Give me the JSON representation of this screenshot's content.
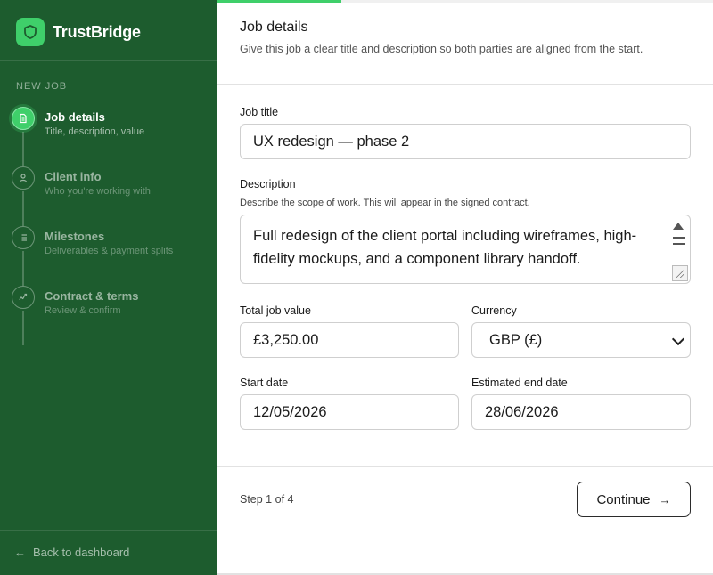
{
  "app": {
    "brand": "TrustBridge",
    "accent_color": "#3fcf6a",
    "sidebar_color": "#1d5c2e"
  },
  "sidebar": {
    "section_label": "NEW JOB",
    "steps": [
      {
        "title": "Job details",
        "subtitle": "Title, description, value",
        "icon": "document-icon",
        "active": true
      },
      {
        "title": "Client info",
        "subtitle": "Who you're working with",
        "icon": "user-icon",
        "active": false
      },
      {
        "title": "Milestones",
        "subtitle": "Deliverables & payment splits",
        "icon": "list-icon",
        "active": false
      },
      {
        "title": "Contract & terms",
        "subtitle": "Review & confirm",
        "icon": "signature-icon",
        "active": false
      }
    ],
    "back_label": "Back to dashboard"
  },
  "progress": {
    "fraction": 0.25
  },
  "header": {
    "title": "Job details",
    "subtitle": "Give this job a clear title and description so both parties are aligned from the start."
  },
  "form": {
    "job_title_label": "Job title",
    "job_title_value": "UX redesign — phase 2",
    "description_label": "Description",
    "description_hint": "Describe the scope of work. This will appear in the signed contract.",
    "description_value": "Full redesign of the client portal including wireframes, high-fidelity mockups, and a component library handoff.",
    "total_label": "Total job value",
    "total_value": "£3,250.00",
    "currency_label": "Currency",
    "currency_value": "GBP (£)",
    "start_label": "Start date",
    "start_value": "12/05/2026",
    "end_label": "Estimated end date",
    "end_value": "28/06/2026"
  },
  "footer": {
    "step_text": "Step 1 of 4",
    "continue_label": "Continue"
  }
}
